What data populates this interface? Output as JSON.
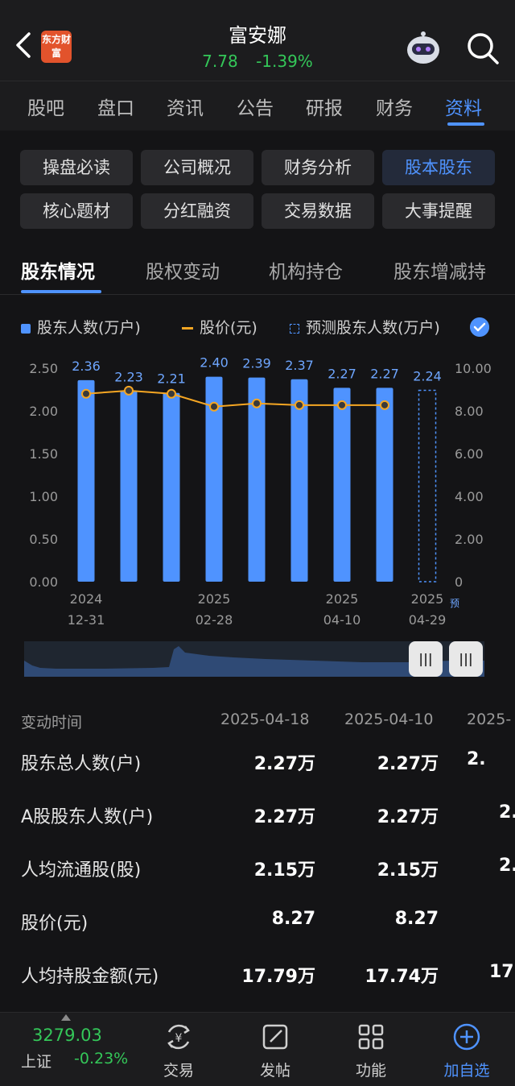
{
  "header": {
    "logo_text": "东方财富",
    "name": "富安娜",
    "price": "7.78",
    "change": "-1.39%"
  },
  "tabs": [
    "股吧",
    "盘口",
    "资讯",
    "公告",
    "研报",
    "财务",
    "资料"
  ],
  "grid_buttons": [
    "操盘必读",
    "公司概况",
    "财务分析",
    "股本股东",
    "核心题材",
    "分红融资",
    "交易数据",
    "大事提醒"
  ],
  "sub_tabs": [
    "股东情况",
    "股权变动",
    "机构持仓",
    "股东增减持"
  ],
  "legend": {
    "bars": "股东人数(万户)",
    "line": "股价(元)",
    "forecast": "预测股东人数(万户)"
  },
  "chart_data": {
    "type": "bar",
    "left_axis_ticks": [
      "2.50",
      "2.00",
      "1.50",
      "1.00",
      "0.50",
      "0.00"
    ],
    "right_axis_ticks": [
      "10.00",
      "8.00",
      "6.00",
      "4.00",
      "2.00",
      "0"
    ],
    "ylim_left": [
      0,
      2.5
    ],
    "ylim_right": [
      0,
      10
    ],
    "bar_values": [
      2.36,
      2.23,
      2.21,
      2.4,
      2.39,
      2.37,
      2.27,
      2.27
    ],
    "bar_labels": [
      "2.36",
      "2.23",
      "2.21",
      "2.40",
      "2.39",
      "2.37",
      "2.27",
      "2.27"
    ],
    "forecast_value": 2.24,
    "forecast_label": "2.24",
    "price_values": [
      8.8,
      8.95,
      8.8,
      8.2,
      8.35,
      8.27,
      8.27,
      8.27
    ],
    "x_labels": [
      {
        "year": "2024",
        "date": "12-31"
      },
      {
        "year": "2025",
        "date": "02-28"
      },
      {
        "year": "2025",
        "date": "04-10"
      },
      {
        "year": "2025",
        "date": "04-29"
      }
    ],
    "forecast_tag": "预",
    "colors": {
      "bar": "#4f93ff",
      "line": "#f5a623"
    }
  },
  "table": {
    "header_label": "变动时间",
    "dates": [
      "2025-04-18",
      "2025-04-10",
      "2025-"
    ],
    "rows": [
      {
        "label": "股东总人数(户)",
        "values": [
          "2.27万",
          "2.27万",
          "2."
        ]
      },
      {
        "label": "A股股东人数(户)",
        "values": [
          "2.27万",
          "2.27万",
          "2."
        ]
      },
      {
        "label": "人均流通股(股)",
        "values": [
          "2.15万",
          "2.15万",
          "2."
        ]
      },
      {
        "label": "股价(元)",
        "values": [
          "8.27",
          "8.27",
          ""
        ]
      },
      {
        "label": "人均持股金额(元)",
        "values": [
          "17.79万",
          "17.74万",
          "17."
        ]
      }
    ]
  },
  "bottom": {
    "index_value": "3279.03",
    "index_name": "上证",
    "index_change": "-0.23%",
    "nav": [
      "交易",
      "发帖",
      "功能",
      "加自选"
    ]
  },
  "colors": {
    "accent": "#4f93ff",
    "down": "#34c759",
    "price_line": "#f5a623"
  }
}
